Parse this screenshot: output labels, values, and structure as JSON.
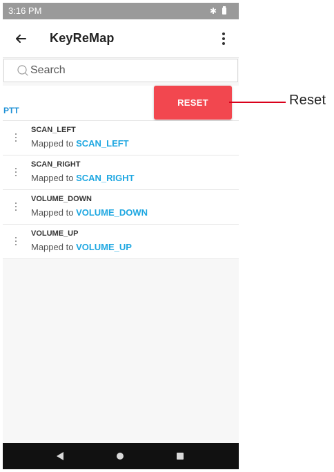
{
  "status_bar": {
    "time": "3:16 PM",
    "icons": [
      "bluetooth-icon",
      "battery-icon"
    ]
  },
  "app_bar": {
    "title": "KeyReMap",
    "back_icon": "arrow-left-icon",
    "menu_icon": "more-vert-icon"
  },
  "search": {
    "placeholder": "Search",
    "icon": "search-icon"
  },
  "group": {
    "label": "PTT",
    "reset_label": "RESET"
  },
  "keys": [
    {
      "name": "SCAN_LEFT",
      "mapping_prefix": "Mapped to",
      "mapping_value": "SCAN_LEFT"
    },
    {
      "name": "SCAN_RIGHT",
      "mapping_prefix": "Mapped to",
      "mapping_value": "SCAN_RIGHT"
    },
    {
      "name": "VOLUME_DOWN",
      "mapping_prefix": "Mapped to",
      "mapping_value": "VOLUME_DOWN"
    },
    {
      "name": "VOLUME_UP",
      "mapping_prefix": "Mapped to",
      "mapping_value": "VOLUME_UP"
    }
  ],
  "callout": {
    "label": "Reset"
  },
  "nav_bar": {
    "icons": [
      "back-icon",
      "home-icon",
      "recents-icon"
    ]
  },
  "colors": {
    "accent_blue": "#1EA7E1",
    "reset_red": "#F2474F",
    "callout_red": "#D9001B",
    "status_gray": "#9A9A9A",
    "nav_black": "#111111"
  }
}
